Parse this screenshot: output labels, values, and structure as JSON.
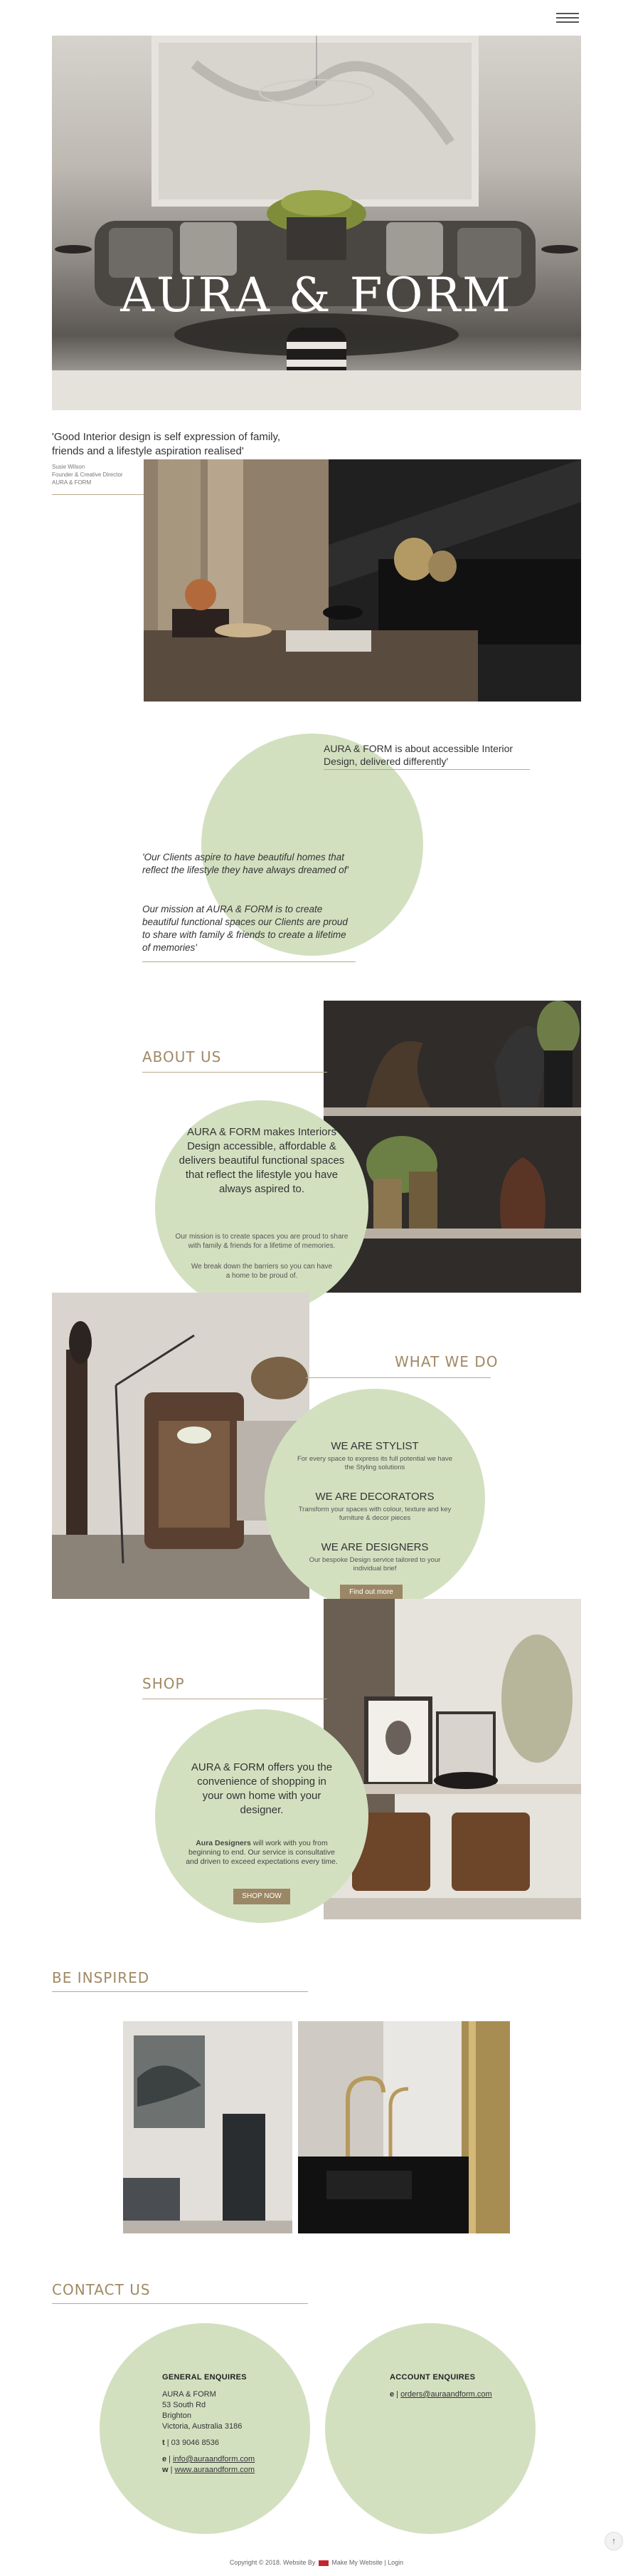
{
  "hero": {
    "title": "AURA & FORM"
  },
  "intro_quote": {
    "text": "'Good Interior design is self expression of family, friends and a lifestyle aspiration realised'",
    "author": "Susie Wilson",
    "role": "Founder & Creative Director",
    "company": "AURA & FORM"
  },
  "about_circle": {
    "tagline": "AURA & FORM is about accessible Interior Design, delivered differently'",
    "quote1": "'Our Clients aspire to have beautiful homes that reflect the lifestyle they have always dreamed of'",
    "quote2": "Our mission at AURA & FORM is to create beautiful functional spaces our Clients are proud to share with family & friends to create a lifetime of memories'"
  },
  "about_us": {
    "heading": "ABOUT US",
    "lead": "AURA & FORM makes Interiors Design accessible, affordable & delivers beautiful functional spaces that reflect the lifestyle you have always aspired to.",
    "p1": "Our mission is to create spaces you are proud to share with family & friends for a lifetime of memories.",
    "p2": "We break down the barriers so you can have a home to be proud of."
  },
  "what_we_do": {
    "heading": "WHAT WE DO",
    "items": [
      {
        "title": "WE ARE STYLIST",
        "text": "For every space to express its full potential we have the Styling solutions"
      },
      {
        "title": "WE ARE DECORATORS",
        "text": "Transform your spaces with colour, texture and key furniture & decor pieces"
      },
      {
        "title": "WE ARE DESIGNERS",
        "text": "Our bespoke Design service tailored to your individual brief"
      }
    ],
    "button": "Find out more"
  },
  "shop": {
    "heading": "SHOP",
    "lead": "AURA & FORM offers you the convenience of shopping in your own home with your designer.",
    "text_bold": "Aura Designers",
    "text": " will work with you from beginning to end. Our service is consultative and driven to exceed expectations every time.",
    "button": "SHOP NOW"
  },
  "inspired": {
    "heading": "BE INSPIRED"
  },
  "contact": {
    "heading": "CONTACT US",
    "general": {
      "title": "GENERAL ENQUIRES",
      "lines": [
        "AURA & FORM",
        "53 South Rd",
        "Brighton",
        "Victoria, Australia 3186"
      ],
      "phone_label": "t",
      "phone": "03 9046 8536",
      "email_label": "e",
      "email": "info@auraandform.com",
      "web_label": "w",
      "web": "www.auraandform.com"
    },
    "account": {
      "title": "ACCOUNT ENQUIRES",
      "email_label": "e",
      "email": "orders@auraandform.com"
    }
  },
  "footer": {
    "copyright": "Copyright © 2018. Website By",
    "credit": "Make My Website",
    "login": "Login"
  },
  "colors": {
    "accent": "#9b8766",
    "circle": "#d3e0c0",
    "gold": "#a08a64"
  },
  "icons": {
    "menu": "hamburger-icon",
    "back_to_top": "arrow-up-icon"
  }
}
